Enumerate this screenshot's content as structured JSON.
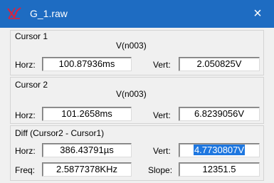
{
  "window": {
    "title": "G_1.raw",
    "close_glyph": "×",
    "icon": "ltspice-waveform-icon"
  },
  "cursor1": {
    "label": "Cursor 1",
    "trace": "V(n003)",
    "horz_label": "Horz:",
    "horz_value": "100.87936ms",
    "vert_label": "Vert:",
    "vert_value": "2.050825V"
  },
  "cursor2": {
    "label": "Cursor 2",
    "trace": "V(n003)",
    "horz_label": "Horz:",
    "horz_value": "101.2658ms",
    "vert_label": "Vert:",
    "vert_value": "6.8239056V"
  },
  "diff": {
    "label": "Diff (Cursor2 - Cursor1)",
    "horz_label": "Horz:",
    "horz_value": "386.43791µs",
    "vert_label": "Vert:",
    "vert_value": "4.7730807V",
    "freq_label": "Freq:",
    "freq_value": "2.5877378KHz",
    "slope_label": "Slope:",
    "slope_value": "12351.5"
  },
  "colors": {
    "titlebar": "#1e6cc2",
    "selection": "#1e77e0"
  }
}
